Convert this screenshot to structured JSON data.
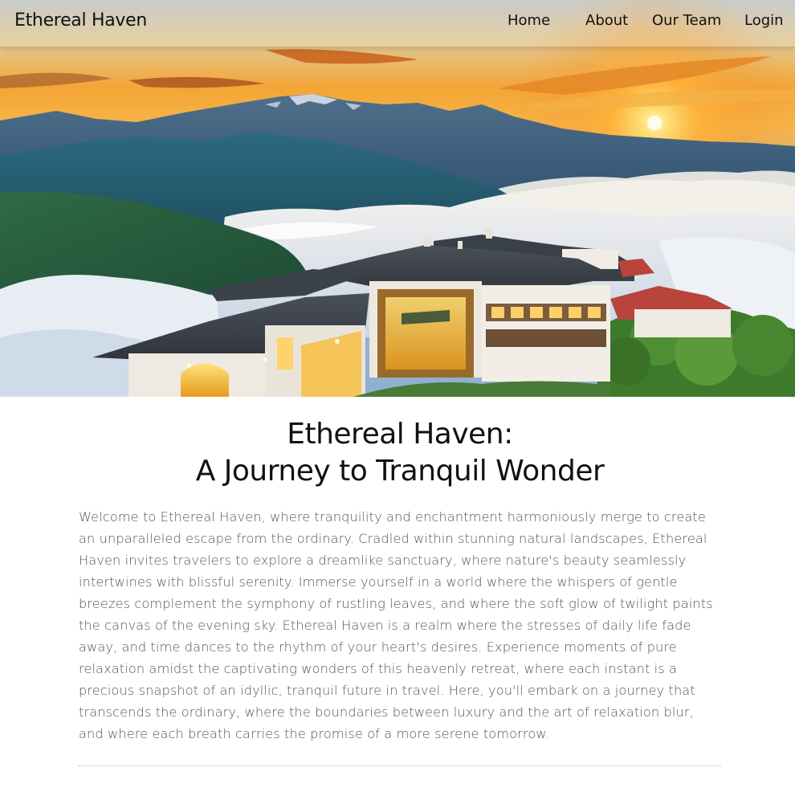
{
  "nav": {
    "brand": "Ethereal Haven",
    "links": [
      "Home",
      "About",
      "Our Team",
      "Login"
    ]
  },
  "hero": {
    "image_subject": "Mountain resort above a sea of clouds at sunset"
  },
  "main": {
    "title_line1": "Ethereal Haven:",
    "title_line2": "A Journey to Tranquil Wonder",
    "intro": "Welcome to Ethereal Haven, where tranquility and enchantment harmoniously merge to create an unparalleled escape from the ordinary. Cradled within stunning natural landscapes, Ethereal Haven invites travelers to explore a dreamlike sanctuary, where nature's beauty seamlessly intertwines with blissful serenity. Immerse yourself in a world where the whispers of gentle breezes complement the symphony of rustling leaves, and where the soft glow of twilight paints the canvas of the evening sky. Ethereal Haven is a realm where the stresses of daily life fade away, and time dances to the rhythm of your heart's desires. Experience moments of pure relaxation amidst the captivating wonders of this heavenly retreat, where each instant is a precious snapshot of an idyllic, tranquil future in travel. Here, you'll embark on a journey that transcends the ordinary, where the boundaries between luxury and the art of relaxation blur, and where each breath carries the promise of a more serene tomorrow."
  },
  "colors": {
    "text_primary": "#111111",
    "text_body": "#555555",
    "sky_warm": "#f2a12a",
    "sun": "#fff4b0",
    "mountain": "#2f5f7e",
    "cloud": "#eef2f8",
    "roof": "#3d434b",
    "wall": "#f1ede6",
    "forest": "#3e7a2c"
  }
}
